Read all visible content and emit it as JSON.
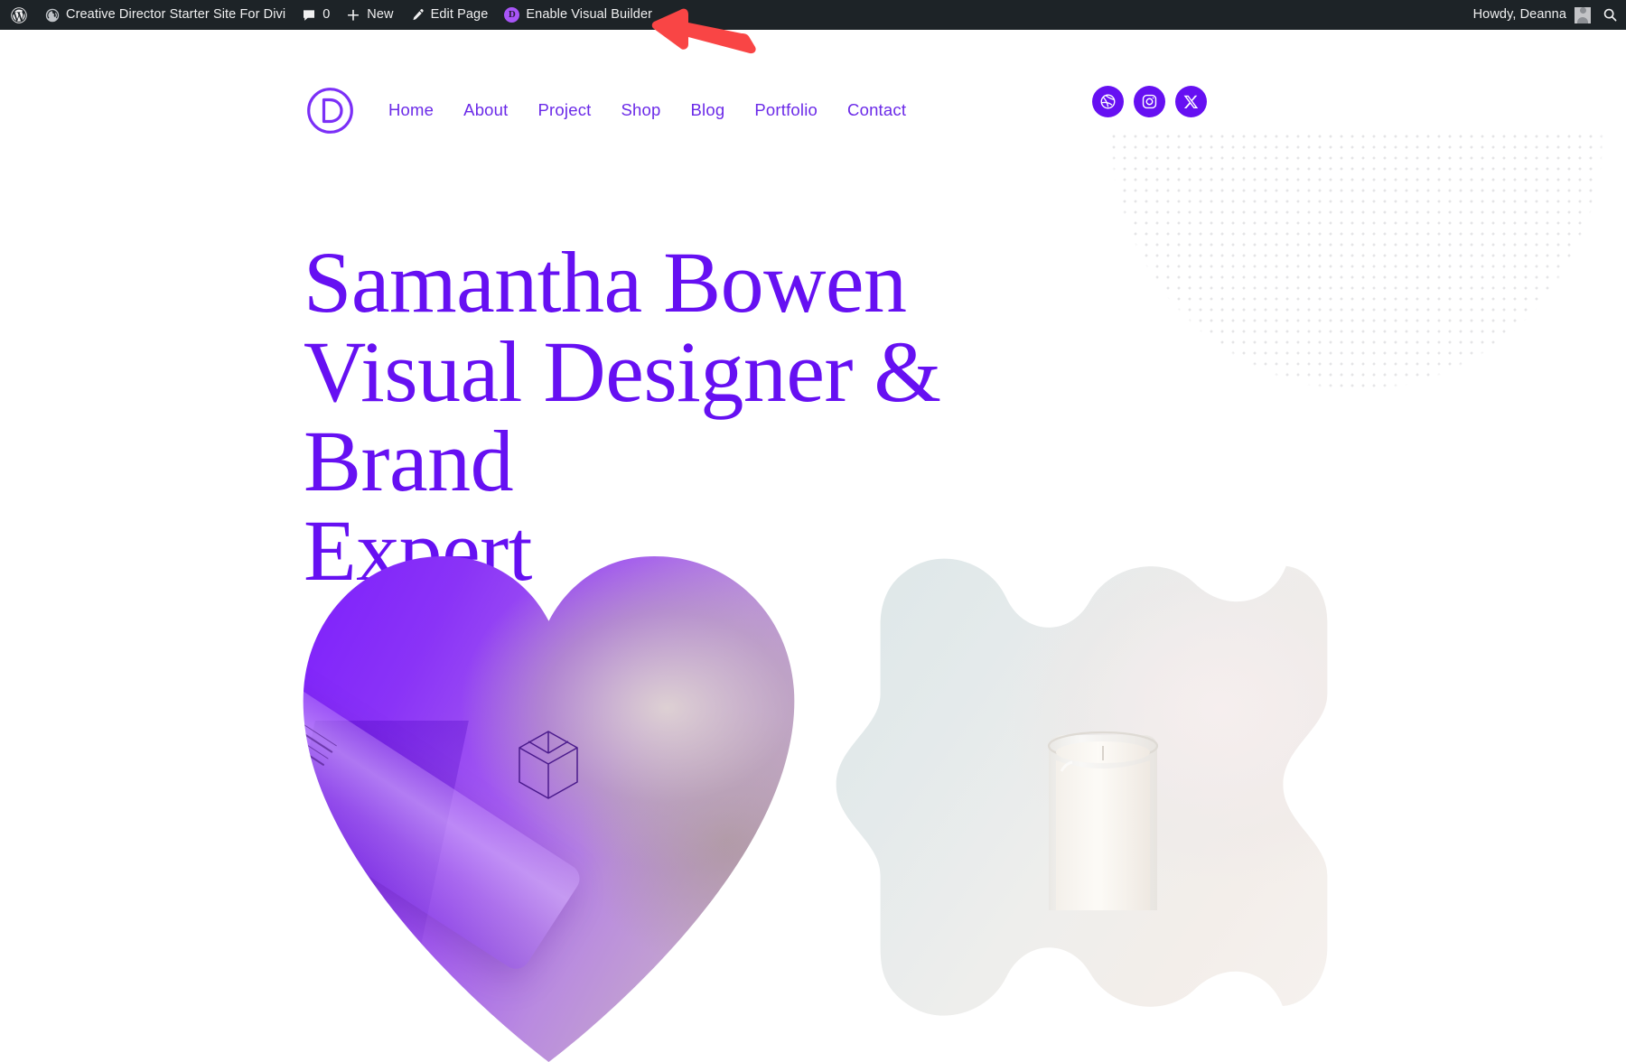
{
  "admin_bar": {
    "wp_logo_icon": "wordpress-logo-icon",
    "site_name": "Creative Director Starter Site For Divi",
    "site_icon": "dashboard-speedometer-icon",
    "comments_icon": "comment-bubble-icon",
    "comments_count": "0",
    "new_icon": "plus-icon",
    "new_label": "New",
    "edit_icon": "pencil-icon",
    "edit_label": "Edit Page",
    "divi_icon": "divi-d-icon",
    "visual_builder_label": "Enable Visual Builder",
    "howdy_label": "Howdy, Deanna",
    "avatar_icon": "user-avatar-icon",
    "search_icon": "search-icon",
    "bar_bg": "#1d2327",
    "text_color": "#f0f0f1"
  },
  "annotation": {
    "arrow_icon": "red-arrow-pointing-left-icon",
    "arrow_color": "#f94545"
  },
  "site": {
    "logo_icon": "divi-circle-d-logo-icon",
    "accent_color": "#6610f2",
    "nav_link_color": "#6b2ae8",
    "nav": [
      {
        "label": "Home"
      },
      {
        "label": "About"
      },
      {
        "label": "Project"
      },
      {
        "label": "Shop"
      },
      {
        "label": "Blog"
      },
      {
        "label": "Portfolio"
      },
      {
        "label": "Contact"
      }
    ],
    "social": [
      {
        "icon": "dribbble-icon",
        "label": "Dribbble"
      },
      {
        "icon": "instagram-icon",
        "label": "Instagram"
      },
      {
        "icon": "x-twitter-icon",
        "label": "X"
      }
    ],
    "hero": {
      "heading": "Samantha Bowen Visual Designer & Brand Expert",
      "heading_line_1": "Samantha Bowen",
      "heading_line_2": "Visual Designer & Brand",
      "heading_line_3": "Expert",
      "heading_color": "#6610f2",
      "decoration_icon": "dotted-grid-pattern",
      "image_left": {
        "name": "heart-shaped-purple-product-photo",
        "shape": "heart",
        "brand_mark_icon": "hexagon-cube-logo-icon"
      },
      "image_right": {
        "name": "wavy-blob-candle-photo",
        "shape": "wavy-blob",
        "subject_icon": "candle-jar"
      }
    }
  }
}
